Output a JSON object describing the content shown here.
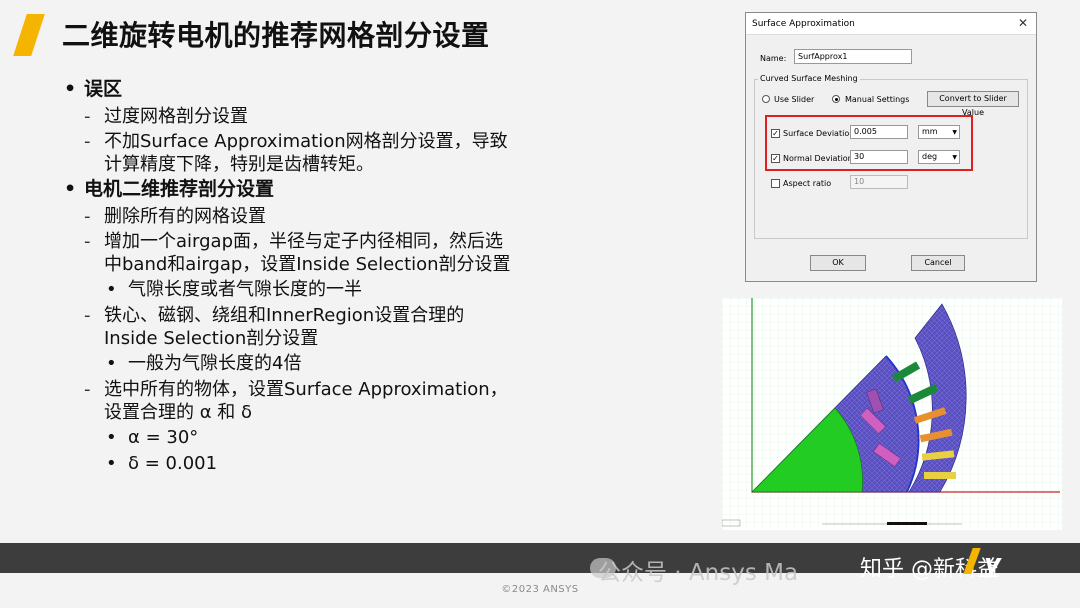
{
  "slide": {
    "title": "二维旋转电机的推荐网格剖分设置",
    "section1": {
      "heading": "误区",
      "items": [
        "过度网格剖分设置",
        "不加Surface Approximation网格剖分设置，导致\n计算精度下降，特别是齿槽转矩。"
      ]
    },
    "section2": {
      "heading": "电机二维推荐剖分设置",
      "item1": "删除所有的网格设置",
      "item2": "增加一个airgap面，半径与定子内径相同，然后选\n中band和airgap，设置Inside Selection剖分设置",
      "item2_sub": "气隙长度或者气隙长度的一半",
      "item3": "铁心、磁钢、绕组和InnerRegion设置合理的\nInside Selection剖分设置",
      "item3_sub": "一般为气隙长度的4倍",
      "item4": "选中所有的物体，设置Surface Approximation，\n设置合理的 α 和 δ",
      "item4_sub1": "α = 30°",
      "item4_sub2": "δ = 0.001"
    }
  },
  "dialog": {
    "title": "Surface Approximation",
    "close_glyph": "✕",
    "name_label": "Name:",
    "name_value": "SurfApprox1",
    "group_label": "Curved Surface Meshing",
    "use_slider": "Use Slider",
    "manual_settings": "Manual Settings",
    "convert_button": "Convert to Slider Value",
    "surface_deviation_label": "Surface Deviation",
    "surface_deviation_value": "0.005",
    "surface_deviation_unit": "mm",
    "normal_deviation_label": "Normal Deviation",
    "normal_deviation_value": "30",
    "normal_deviation_unit": "deg",
    "aspect_ratio_label": "Aspect ratio",
    "aspect_ratio_value": "10",
    "ok_button": "OK",
    "cancel_button": "Cancel",
    "check_glyph": "✓",
    "dropdown_glyph": "▼"
  },
  "footer": {
    "watermark": "公众号 · Ansys Ma",
    "zhihu": "知乎 @新科益",
    "logo": "y",
    "copyright": "©2023 ANSYS"
  },
  "colors": {
    "accent": "#f5b400",
    "highlight": "#e02020",
    "footer": "#3d3d3d",
    "rotor": "#22cc22",
    "stator_mesh": "#5a4fc0",
    "magnet": "#d060c0",
    "coil_orange": "#e89030",
    "coil_yellow": "#e8d040",
    "coil_green": "#1a8a3a"
  }
}
